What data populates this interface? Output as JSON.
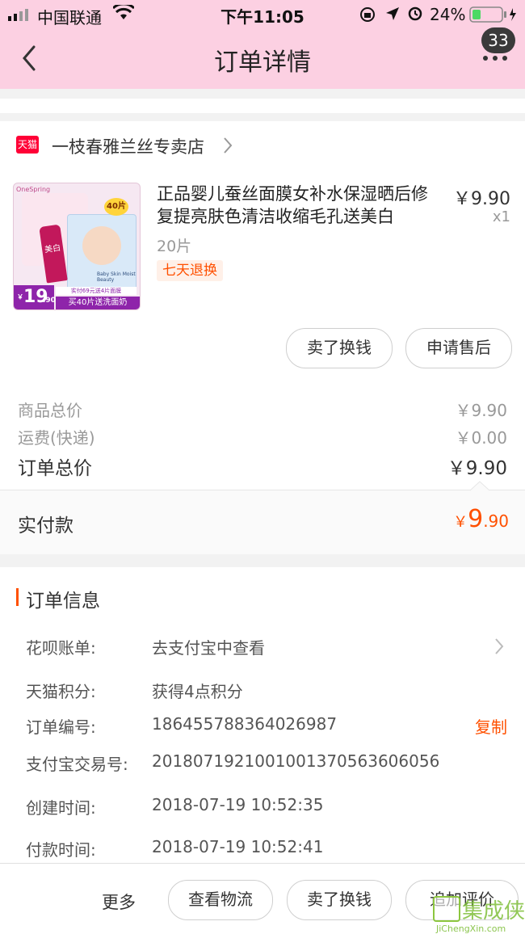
{
  "status_bar": {
    "carrier": "中国联通",
    "time": "下午11:05",
    "battery": "24%"
  },
  "nav": {
    "title": "订单详情",
    "badge_count": "33"
  },
  "store": {
    "badge": "天猫",
    "name": "一枝春雅兰丝专卖店"
  },
  "product": {
    "title": "正品婴儿蚕丝面膜女补水保湿晒后修复提亮肤色清洁收缩毛孔送美白",
    "spec": "20片",
    "tag": "七天退换",
    "price": "￥9.90",
    "qty": "x1",
    "image": {
      "brand": "OneSpring",
      "tag_40": "40片",
      "cream": "美白",
      "box_text": "Baby Skin Moist Beauty",
      "price_big": "19",
      "price_small": ".90",
      "promo_top": "实付69元送4片面膜",
      "promo_bottom": "买40片送洗面奶"
    }
  },
  "item_actions": {
    "sell": "卖了换钱",
    "after_sale": "申请售后"
  },
  "price_summary": {
    "goods_label": "商品总价",
    "goods_value": "￥9.90",
    "shipping_label": "运费(快递)",
    "shipping_value": "￥0.00",
    "total_label": "订单总价",
    "total_value": "￥9.90",
    "paid_label": "实付款",
    "paid_currency": "￥",
    "paid_int": "9",
    "paid_dec": ".90"
  },
  "order_info": {
    "heading": "订单信息",
    "rows": [
      {
        "label": "花呗账单:",
        "value": "去支付宝中查看"
      },
      {
        "label": "天猫积分:",
        "value": "获得4点积分"
      },
      {
        "label": "订单编号:",
        "value": "186455788364026987",
        "action": "复制"
      },
      {
        "label": "支付宝交易号:",
        "value": "2018071921001001370563606056"
      },
      {
        "label": "创建时间:",
        "value": "2018-07-19 10:52:35"
      },
      {
        "label": "付款时间:",
        "value": "2018-07-19 10:52:41"
      }
    ]
  },
  "bottom_bar": {
    "more": "更多",
    "logistics": "查看物流",
    "sell": "卖了换钱",
    "review": "追加评价"
  },
  "watermark": {
    "text": "集成侠",
    "url": "JiChengXin.com"
  },
  "colors": {
    "accent_orange": "#ff5000",
    "tmall_red": "#ff0036",
    "nav_pink": "#fcd0e2"
  }
}
